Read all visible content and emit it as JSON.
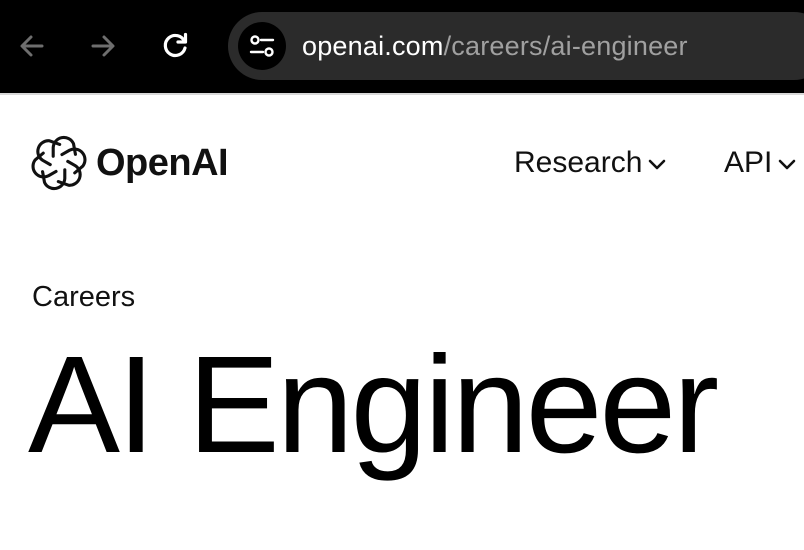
{
  "browser": {
    "url_host": "openai.com",
    "url_path": "/careers/ai-engineer",
    "icons": {
      "back": "arrow-left-icon",
      "forward": "arrow-right-icon",
      "reload": "reload-icon",
      "site_info": "tune-icon"
    },
    "colors": {
      "toolbar_bg": "#000000",
      "address_bg": "#2b2b2b",
      "host_text": "#ffffff",
      "path_text": "#a0a0a0"
    }
  },
  "header": {
    "logo_text": "OpenAI",
    "logo_icon": "openai-logo-icon",
    "nav": [
      {
        "label": "Research",
        "icon": "chevron-down-icon"
      },
      {
        "label": "API",
        "icon": "chevron-down-icon"
      }
    ]
  },
  "main": {
    "eyebrow": "Careers",
    "title": "AI Engineer"
  }
}
